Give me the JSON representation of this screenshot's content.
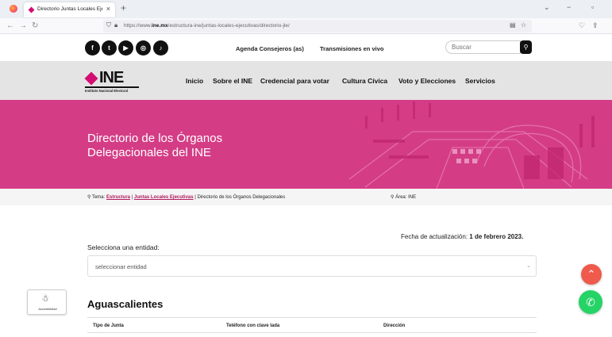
{
  "browser": {
    "tab_title": "Directorio Juntas Locales Ejecu",
    "url_prefix": "https://www.",
    "url_domain": "ine.mx",
    "url_path": "/estructura-ine/juntas-locales-ejecutivas/directorio-jle/"
  },
  "social": [
    "f",
    "t",
    "▶",
    "◎",
    "♪"
  ],
  "toplinks": {
    "agenda": "Agenda Consejeros (as)",
    "trans": "Transmisiones en vivo"
  },
  "search": {
    "placeholder": "Buscar"
  },
  "logo": {
    "text": "INE",
    "sub": "Instituto Nacional Electoral"
  },
  "menu": [
    "Inicio",
    "Sobre el INE",
    "Credencial para votar",
    "Cultura Cívica",
    "Voto y Elecciones",
    "Servicios"
  ],
  "hero": {
    "title": "Directorio de los Órganos Delegacionales del INE"
  },
  "breadcrumb": {
    "prefix": "Tema:",
    "link1": "Estructura",
    "link2": "Juntas Locales Ejecutivas",
    "current": "Directorio de los Órganos Delegacionales",
    "area": "Área: INE"
  },
  "update": {
    "label": "Fecha de actualización:",
    "date": "1 de febrero 2023."
  },
  "entity": {
    "label": "Selecciona una entidad:",
    "value": "seleccionar entidad"
  },
  "accessibility": {
    "label": "Accesibilidad"
  },
  "state": {
    "name": "Aguascalientes"
  },
  "table": {
    "headers": [
      "Tipo de Junta",
      "Teléfono con clave lada",
      "Dirección"
    ]
  },
  "colors": {
    "brand": "#d40e71",
    "hero_bg": "#d43d86",
    "whatsapp": "#25d366",
    "scroll_top": "#ef5a4c"
  }
}
